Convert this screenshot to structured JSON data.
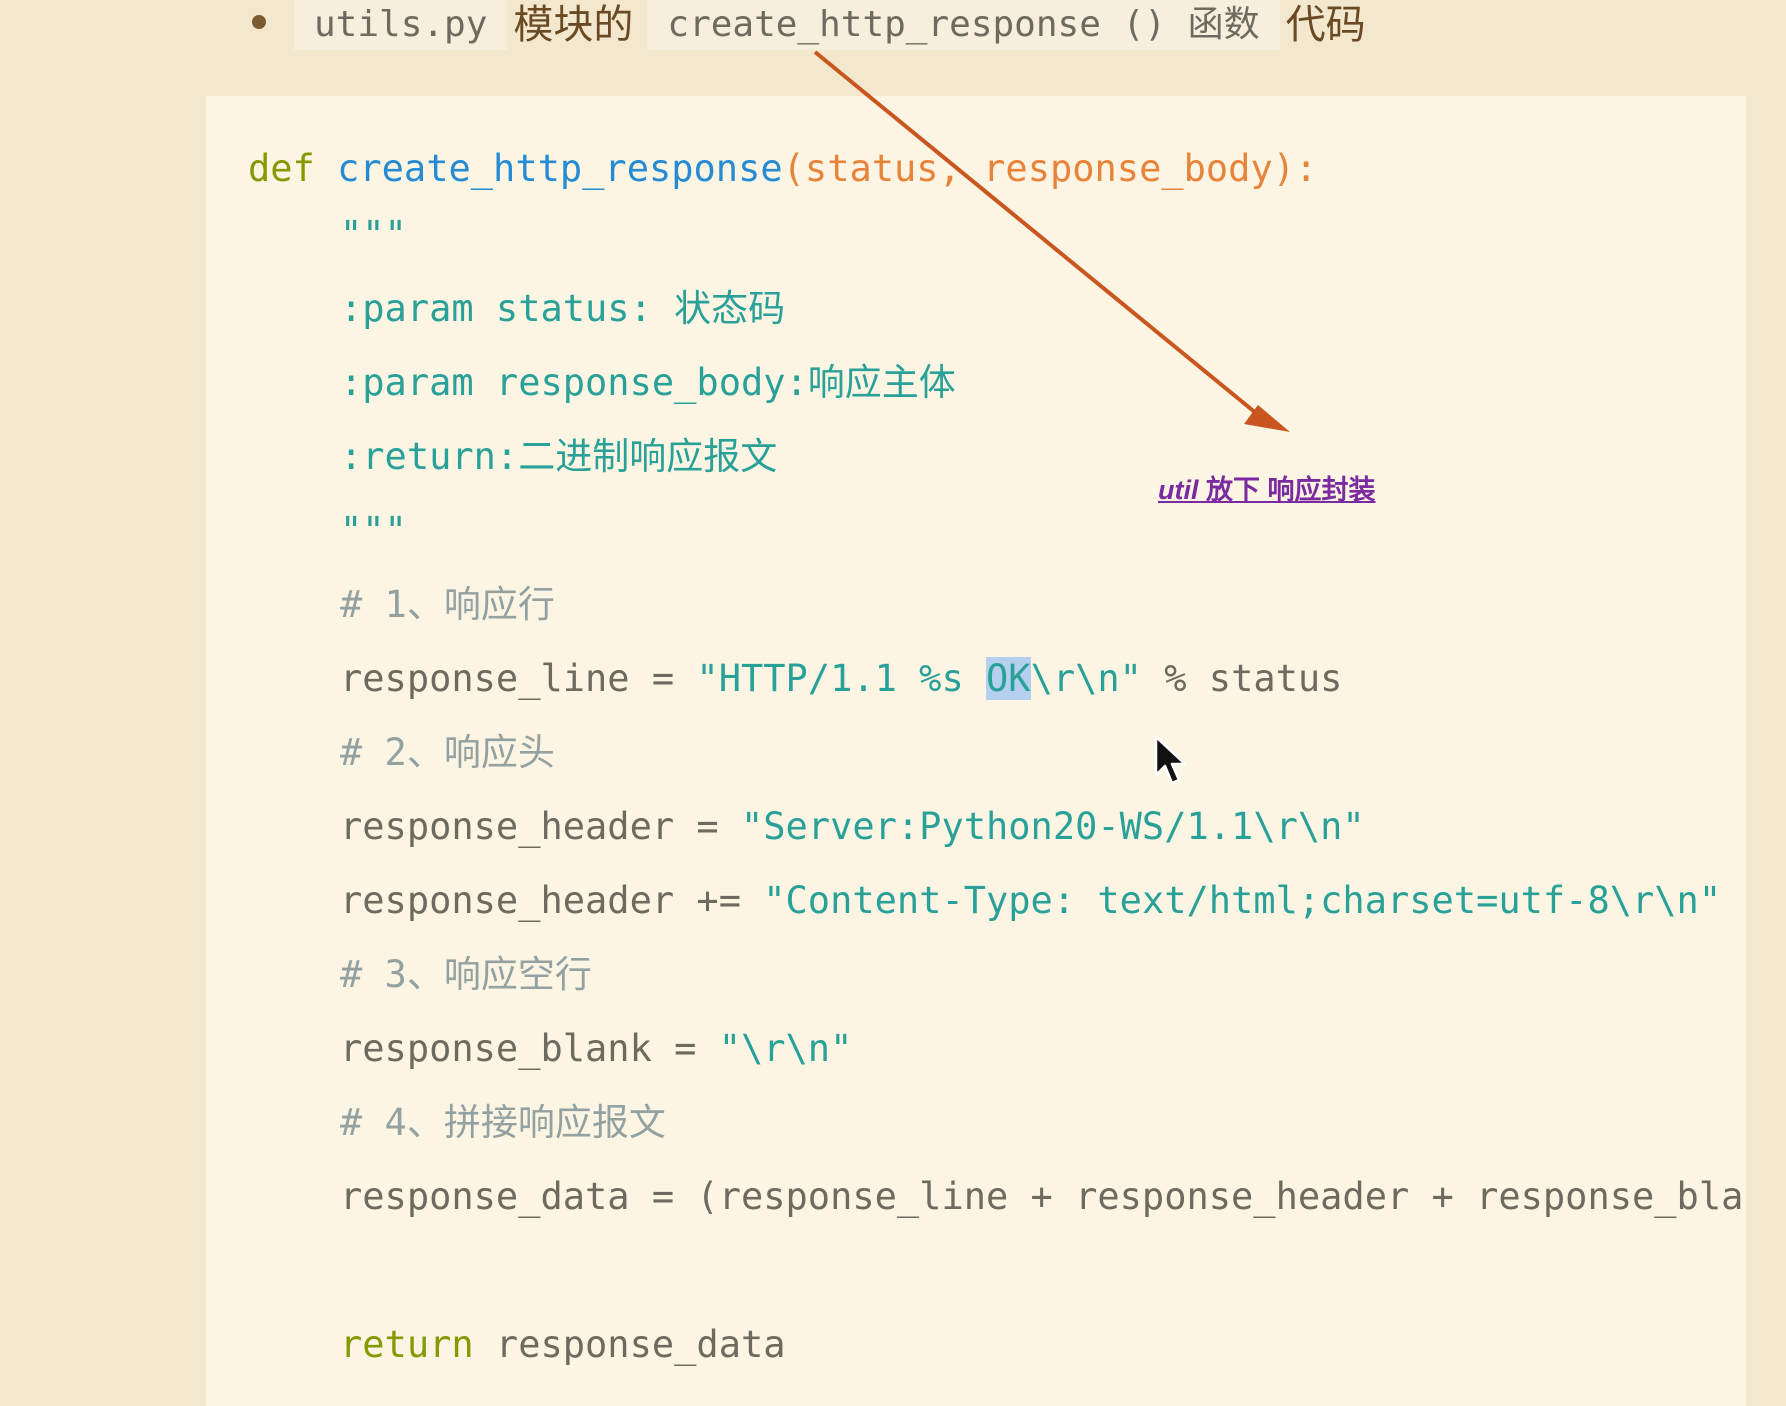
{
  "header": {
    "file": "utils.py",
    "text_module": "模块的",
    "func": "create_http_response",
    "paren": "()",
    "func_word": "函数",
    "text_code": "代码"
  },
  "code": {
    "def_kw": "def",
    "func_name": "create_http_response",
    "open_paren": "(",
    "param1": "status",
    "comma": ", ",
    "param2": "response_body",
    "close": "):",
    "docstring_open": "\"\"\"",
    "param_status": ":param status: 状态码",
    "param_body": ":param response_body:响应主体",
    "return_doc": ":return:二进制响应报文",
    "docstring_close": "\"\"\"",
    "comment1": "# 1、响应行",
    "line1_left": "response_line = ",
    "line1_str_a": "\"HTTP/1.1 %s ",
    "line1_sel": "OK",
    "line1_str_b": "\\r\\n\"",
    "line1_right": " % status",
    "comment2": "# 2、响应头",
    "line2_left": "response_header = ",
    "line2_str": "\"Server:Python20-WS/1.1\\r\\n\"",
    "line3_left": "response_header += ",
    "line3_str": "\"Content-Type: text/html;charset=utf-8\\r\\n\"",
    "comment3": "# 3、响应空行",
    "line4_left": "response_blank = ",
    "line4_str": "\"\\r\\n\"",
    "comment4": "# 4、拼接响应报文",
    "line5": "response_data = (response_line + response_header + response_blank",
    "return_kw": "return",
    "return_val": " response_data"
  },
  "annotation": {
    "italic": "util",
    "rest": " 放下 响应封装"
  },
  "colors": {
    "arrow": "#c9561e",
    "annotation": "#7b2aa0",
    "background": "#f3e8cd",
    "code_bg": "#fcf5e4"
  },
  "icons": {
    "bullet": "bullet-dot-icon",
    "cursor": "mouse-pointer-icon",
    "arrow": "annotation-arrow"
  }
}
